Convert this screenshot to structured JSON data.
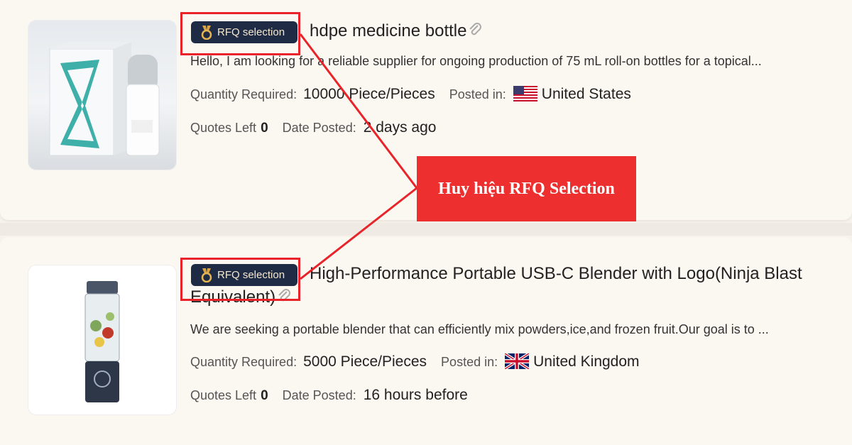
{
  "callout": {
    "text": "Huy hiệu RFQ Selection"
  },
  "labels": {
    "quantity_required": "Quantity Required:",
    "posted_in": "Posted in:",
    "quotes_left": "Quotes Left",
    "date_posted": "Date Posted:"
  },
  "listings": [
    {
      "badge": "RFQ selection",
      "title": "hdpe medicine bottle",
      "description": "Hello, I am looking for a reliable supplier for ongoing production of 75 mL roll-on bottles for a topical...",
      "quantity": "10000 Piece/Pieces",
      "country": "United States",
      "flag": "us-flag-icon",
      "quotes_left": "0",
      "date_posted": "2 days ago"
    },
    {
      "badge": "RFQ selection",
      "title_line1": "High-Performance Portable USB-C Blender with Logo(Ninja Blast",
      "title_line2": "Equivalent)",
      "description": "We are seeking a portable blender that can efficiently mix powders,ice,and frozen fruit.Our goal is to ...",
      "quantity": "5000 Piece/Pieces",
      "country": "United Kingdom",
      "flag": "uk-flag-icon",
      "quotes_left": "0",
      "date_posted": "16 hours before"
    }
  ],
  "colors": {
    "badge_bg": "#1f2a44",
    "highlight": "#e8242a",
    "callout_bg": "#ee2f2f"
  }
}
